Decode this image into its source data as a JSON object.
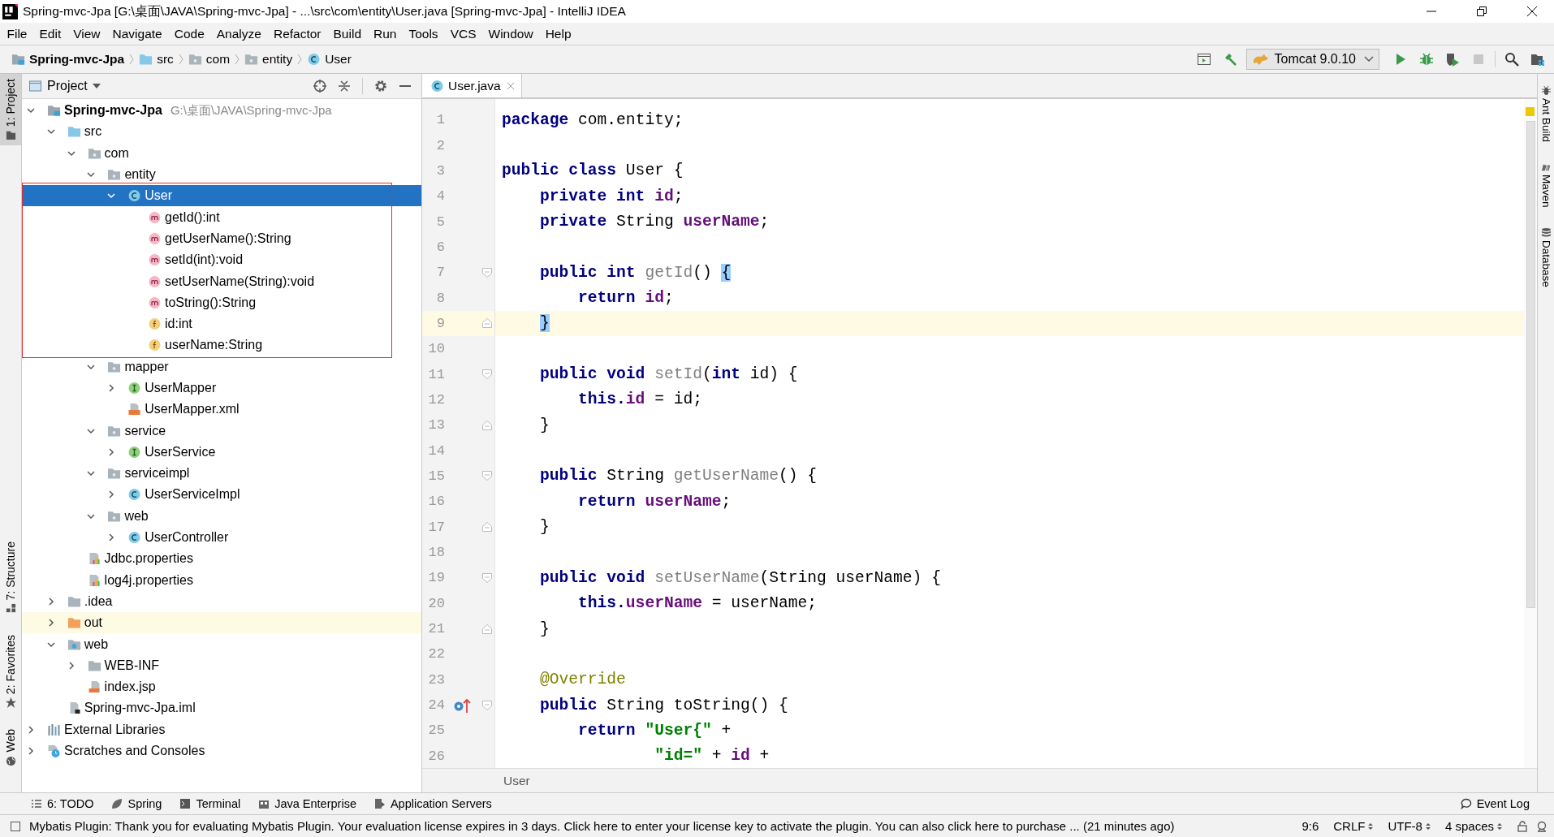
{
  "window": {
    "title": "Spring-mvc-Jpa [G:\\桌面\\JAVA\\Spring-mvc-Jpa] - ...\\src\\com\\entity\\User.java [Spring-mvc-Jpa] - IntelliJ IDEA"
  },
  "menu": [
    "File",
    "Edit",
    "View",
    "Navigate",
    "Code",
    "Analyze",
    "Refactor",
    "Build",
    "Run",
    "Tools",
    "VCS",
    "Window",
    "Help"
  ],
  "breadcrumbs": [
    {
      "label": "Spring-mvc-Jpa",
      "kind": "module"
    },
    {
      "label": "src",
      "kind": "source-folder"
    },
    {
      "label": "com",
      "kind": "package"
    },
    {
      "label": "entity",
      "kind": "package"
    },
    {
      "label": "User",
      "kind": "class"
    }
  ],
  "run_config": {
    "label": "Tomcat 9.0.10"
  },
  "left_tool_tabs": [
    {
      "label": "1: Project",
      "selected": true
    },
    {
      "label": "7: Structure",
      "selected": false
    },
    {
      "label": "2: Favorites",
      "selected": false
    },
    {
      "label": "Web",
      "selected": false
    }
  ],
  "project": {
    "title": "Project",
    "tree": [
      {
        "label": "Spring-mvc-Jpa",
        "detail": "G:\\桌面\\JAVA\\Spring-mvc-Jpa",
        "kind": "module",
        "expanded": true,
        "selected": false,
        "children": [
          {
            "label": "src",
            "kind": "source-folder",
            "expanded": true,
            "selected": false,
            "children": [
              {
                "label": "com",
                "kind": "package",
                "expanded": true,
                "selected": false,
                "children": [
                  {
                    "label": "entity",
                    "kind": "package",
                    "expanded": true,
                    "selected": false,
                    "children": [
                      {
                        "label": "User",
                        "kind": "class",
                        "expanded": true,
                        "selected": true,
                        "boxed": true,
                        "children": [
                          {
                            "label": "getId():int",
                            "kind": "method",
                            "selected": false
                          },
                          {
                            "label": "getUserName():String",
                            "kind": "method",
                            "selected": false
                          },
                          {
                            "label": "setId(int):void",
                            "kind": "method",
                            "selected": false
                          },
                          {
                            "label": "setUserName(String):void",
                            "kind": "method",
                            "selected": false
                          },
                          {
                            "label": "toString():String",
                            "kind": "method",
                            "selected": false
                          },
                          {
                            "label": "id:int",
                            "kind": "field",
                            "selected": false
                          },
                          {
                            "label": "userName:String",
                            "kind": "field",
                            "selected": false
                          }
                        ]
                      }
                    ]
                  },
                  {
                    "label": "mapper",
                    "kind": "package",
                    "expanded": true,
                    "selected": false,
                    "children": [
                      {
                        "label": "UserMapper",
                        "kind": "interface",
                        "expanded": false,
                        "selected": false
                      },
                      {
                        "label": "UserMapper.xml",
                        "kind": "xml",
                        "selected": false
                      }
                    ]
                  },
                  {
                    "label": "service",
                    "kind": "package",
                    "expanded": true,
                    "selected": false,
                    "children": [
                      {
                        "label": "UserService",
                        "kind": "interface",
                        "expanded": false,
                        "selected": false
                      }
                    ]
                  },
                  {
                    "label": "serviceimpl",
                    "kind": "package",
                    "expanded": true,
                    "selected": false,
                    "children": [
                      {
                        "label": "UserServiceImpl",
                        "kind": "class",
                        "expanded": false,
                        "selected": false
                      }
                    ]
                  },
                  {
                    "label": "web",
                    "kind": "package",
                    "expanded": true,
                    "selected": false,
                    "children": [
                      {
                        "label": "UserController",
                        "kind": "class",
                        "expanded": false,
                        "selected": false
                      }
                    ]
                  }
                ]
              },
              {
                "label": "Jdbc.properties",
                "kind": "properties",
                "selected": false
              },
              {
                "label": "log4j.properties",
                "kind": "properties",
                "selected": false
              }
            ]
          },
          {
            "label": ".idea",
            "kind": "folder",
            "expanded": false,
            "selected": false
          },
          {
            "label": "out",
            "kind": "excluded-folder",
            "expanded": false,
            "selected": false
          },
          {
            "label": "web",
            "kind": "web-folder",
            "expanded": true,
            "selected": false,
            "children": [
              {
                "label": "WEB-INF",
                "kind": "folder",
                "expanded": false,
                "selected": false
              },
              {
                "label": "index.jsp",
                "kind": "jsp",
                "selected": false
              }
            ]
          },
          {
            "label": "Spring-mvc-Jpa.iml",
            "kind": "iml",
            "selected": false
          }
        ]
      },
      {
        "label": "External Libraries",
        "kind": "libraries",
        "expanded": false,
        "selected": false
      },
      {
        "label": "Scratches and Consoles",
        "kind": "scratches",
        "expanded": false,
        "selected": false
      }
    ]
  },
  "editor": {
    "tabs": [
      {
        "label": "User.java",
        "selected": true
      }
    ],
    "breadcrumb": "User",
    "lines": [
      {
        "number": "1",
        "current": false,
        "kind": "plain",
        "tokens": [
          {
            "text": "package ",
            "kind": "keyword"
          },
          {
            "text": "com.entity;",
            "kind": "plain"
          }
        ]
      },
      {
        "number": "2",
        "current": false,
        "kind": "plain"
      },
      {
        "number": "3",
        "current": false,
        "kind": "plain",
        "tokens": [
          {
            "text": "public class ",
            "kind": "keyword"
          },
          {
            "text": "User {",
            "kind": "plain"
          }
        ]
      },
      {
        "number": "4",
        "current": false,
        "kind": "plain",
        "tokens": [
          {
            "text": "    private int ",
            "kind": "keyword"
          },
          {
            "text": "id",
            "kind": "field"
          },
          {
            "text": ";",
            "kind": "plain"
          }
        ]
      },
      {
        "number": "5",
        "current": false,
        "kind": "plain",
        "tokens": [
          {
            "text": "    private ",
            "kind": "keyword"
          },
          {
            "text": "String ",
            "kind": "plain"
          },
          {
            "text": "userName",
            "kind": "field"
          },
          {
            "text": ";",
            "kind": "plain"
          }
        ]
      },
      {
        "number": "6",
        "current": false,
        "kind": "plain"
      },
      {
        "number": "7",
        "current": false,
        "kind": "fold-start",
        "tokens": [
          {
            "text": "    public int ",
            "kind": "keyword"
          },
          {
            "text": "getId",
            "kind": "unused"
          },
          {
            "text": "() ",
            "kind": "plain"
          },
          {
            "text": "{",
            "kind": "match"
          }
        ]
      },
      {
        "number": "8",
        "current": false,
        "kind": "plain",
        "tokens": [
          {
            "text": "        return ",
            "kind": "keyword"
          },
          {
            "text": "id",
            "kind": "field"
          },
          {
            "text": ";",
            "kind": "plain"
          }
        ]
      },
      {
        "number": "9",
        "current": true,
        "kind": "fold-end",
        "tokens": [
          {
            "text": "    }",
            "kind": "match"
          }
        ]
      },
      {
        "number": "10",
        "current": false,
        "kind": "plain"
      },
      {
        "number": "11",
        "current": false,
        "kind": "fold-start",
        "tokens": [
          {
            "text": "    public void ",
            "kind": "keyword"
          },
          {
            "text": "setId",
            "kind": "unused"
          },
          {
            "text": "(",
            "kind": "plain"
          },
          {
            "text": "int",
            "kind": "keyword"
          },
          {
            "text": " id) {",
            "kind": "plain"
          }
        ]
      },
      {
        "number": "12",
        "current": false,
        "kind": "plain",
        "tokens": [
          {
            "text": "        this.",
            "kind": "keyword"
          },
          {
            "text": "id",
            "kind": "field"
          },
          {
            "text": " = id;",
            "kind": "plain"
          }
        ]
      },
      {
        "number": "13",
        "current": false,
        "kind": "fold-end",
        "tokens": [
          {
            "text": "    }",
            "kind": "plain"
          }
        ]
      },
      {
        "number": "14",
        "current": false,
        "kind": "plain"
      },
      {
        "number": "15",
        "current": false,
        "kind": "fold-start",
        "tokens": [
          {
            "text": "    public ",
            "kind": "keyword"
          },
          {
            "text": "String ",
            "kind": "plain"
          },
          {
            "text": "getUserName",
            "kind": "unused"
          },
          {
            "text": "() {",
            "kind": "plain"
          }
        ]
      },
      {
        "number": "16",
        "current": false,
        "kind": "plain",
        "tokens": [
          {
            "text": "        return ",
            "kind": "keyword"
          },
          {
            "text": "userName",
            "kind": "field"
          },
          {
            "text": ";",
            "kind": "plain"
          }
        ]
      },
      {
        "number": "17",
        "current": false,
        "kind": "fold-end",
        "tokens": [
          {
            "text": "    }",
            "kind": "plain"
          }
        ]
      },
      {
        "number": "18",
        "current": false,
        "kind": "plain"
      },
      {
        "number": "19",
        "current": false,
        "kind": "fold-start",
        "tokens": [
          {
            "text": "    public void ",
            "kind": "keyword"
          },
          {
            "text": "setUserName",
            "kind": "unused"
          },
          {
            "text": "(String userName) {",
            "kind": "plain"
          }
        ]
      },
      {
        "number": "20",
        "current": false,
        "kind": "plain",
        "tokens": [
          {
            "text": "        this.",
            "kind": "keyword"
          },
          {
            "text": "userName",
            "kind": "field"
          },
          {
            "text": " = userName;",
            "kind": "plain"
          }
        ]
      },
      {
        "number": "21",
        "current": false,
        "kind": "fold-end",
        "tokens": [
          {
            "text": "    }",
            "kind": "plain"
          }
        ]
      },
      {
        "number": "22",
        "current": false,
        "kind": "plain"
      },
      {
        "number": "23",
        "current": false,
        "kind": "plain",
        "tokens": [
          {
            "text": "    @Override",
            "kind": "annotation"
          }
        ]
      },
      {
        "number": "24",
        "current": false,
        "kind": "override",
        "tokens": [
          {
            "text": "    public ",
            "kind": "keyword"
          },
          {
            "text": "String toString() {",
            "kind": "plain"
          }
        ]
      },
      {
        "number": "25",
        "current": false,
        "kind": "plain",
        "tokens": [
          {
            "text": "        return ",
            "kind": "keyword"
          },
          {
            "text": "\"User{\"",
            "kind": "string"
          },
          {
            "text": " +",
            "kind": "plain"
          }
        ]
      },
      {
        "number": "26",
        "current": false,
        "kind": "plain",
        "tokens": [
          {
            "text": "                \"id=\"",
            "kind": "string"
          },
          {
            "text": " + ",
            "kind": "plain"
          },
          {
            "text": "id",
            "kind": "field"
          },
          {
            "text": " +",
            "kind": "plain"
          }
        ]
      }
    ]
  },
  "right_tool_tabs": [
    {
      "label": "Ant Build"
    },
    {
      "label": "Maven"
    },
    {
      "label": "Database"
    }
  ],
  "tool_windows": [
    {
      "label": "6: TODO"
    },
    {
      "label": "Spring"
    },
    {
      "label": "Terminal"
    },
    {
      "label": "Java Enterprise"
    },
    {
      "label": "Application Servers"
    }
  ],
  "event_log": "Event Log",
  "status": {
    "message": "Mybatis Plugin: Thank you for evaluating Mybatis Plugin. Your evaluation license expires in 3 days.  Click here to enter your license key to activate the plugin. You can also click here to purchase ... (21 minutes ago)",
    "position": "9:6",
    "line_separator": "CRLF",
    "encoding": "UTF-8",
    "indent": "4 spaces"
  }
}
